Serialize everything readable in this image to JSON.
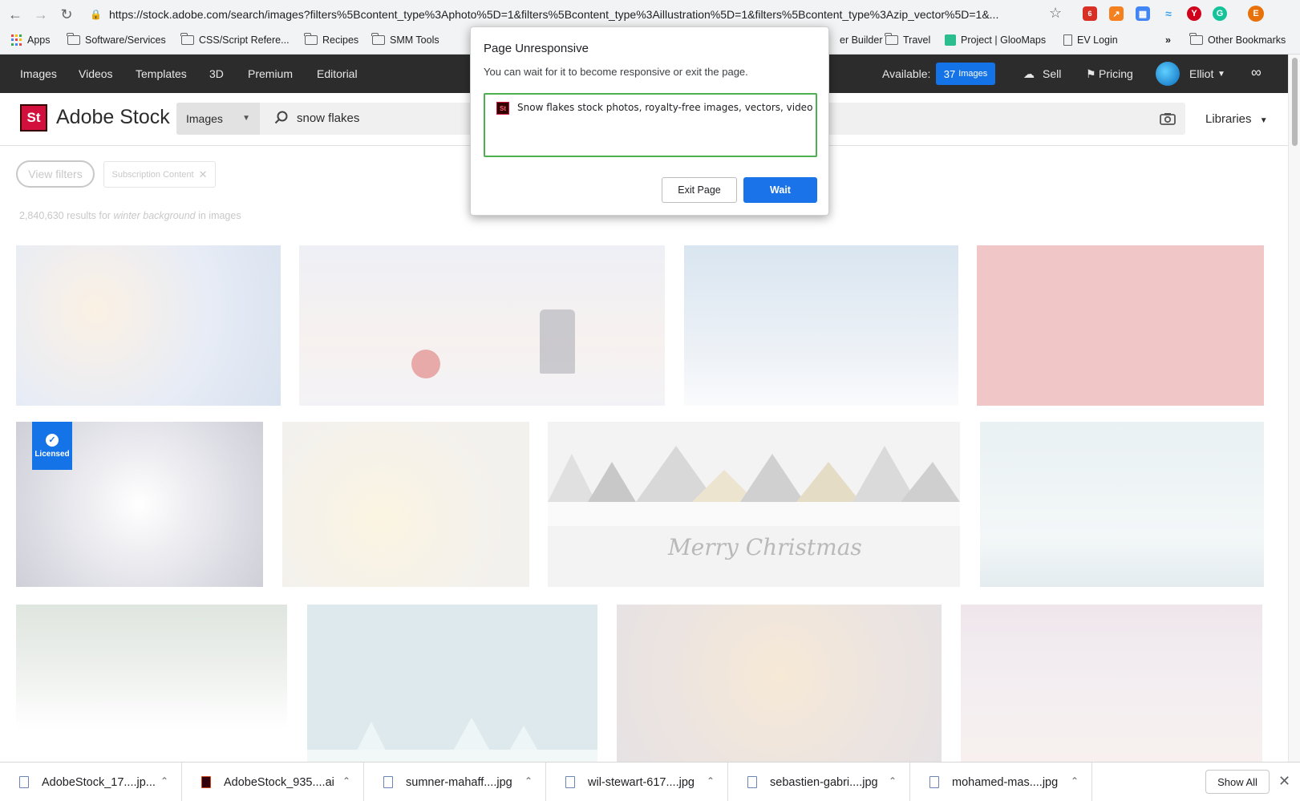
{
  "browser": {
    "url": "https://stock.adobe.com/search/images?filters%5Bcontent_type%3Aphoto%5D=1&filters%5Bcontent_type%3Aillustration%5D=1&filters%5Bcontent_type%3Azip_vector%5D=1&...",
    "extension_badge": "6",
    "profile_initial": "E",
    "bookmarks": [
      "Apps",
      "Software/Services",
      "CSS/Script Refere...",
      "Recipes",
      "SMM Tools",
      "er Builder",
      "Travel",
      "Project | GlooMaps",
      "EV Login"
    ],
    "overflow_label": "»",
    "other_bookmarks": "Other Bookmarks"
  },
  "nav": {
    "items": [
      "Images",
      "Videos",
      "Templates",
      "3D",
      "Premium",
      "Editorial"
    ],
    "available_label": "Available:",
    "available_count": "37",
    "available_unit": "Images",
    "sell": "Sell",
    "pricing": "Pricing",
    "user": "Elliot"
  },
  "header": {
    "logo": "St",
    "brand": "Adobe Stock",
    "type_select": "Images",
    "search_query": "snow flakes",
    "libraries": "Libraries"
  },
  "content": {
    "view_filters": "View filters",
    "chip": "Subscription Content",
    "results_count": "2,840,630 results for",
    "results_query": "winter background",
    "results_suffix": "in images",
    "licensed": "Licensed",
    "merry_christmas": "Merry Christmas"
  },
  "dialog": {
    "title": "Page Unresponsive",
    "message": "You can wait for it to become responsive or exit the page.",
    "favicon": "St",
    "entry": "Snow flakes stock photos, royalty-free images, vectors, video",
    "exit_button": "Exit Page",
    "wait_button": "Wait"
  },
  "downloads": {
    "items": [
      "AdobeStock_17....jp...",
      "AdobeStock_935....ai",
      "sumner-mahaff....jpg",
      "wil-stewart-617....jpg",
      "sebastien-gabri....jpg",
      "mohamed-mas....jpg"
    ],
    "show_all": "Show All"
  },
  "colors": {
    "accent": "#1473e6",
    "brand_red": "#d3103d",
    "nav_bg": "#2c2c2c",
    "dialog_primary": "#1a73e8",
    "list_border": "#4caf50"
  }
}
